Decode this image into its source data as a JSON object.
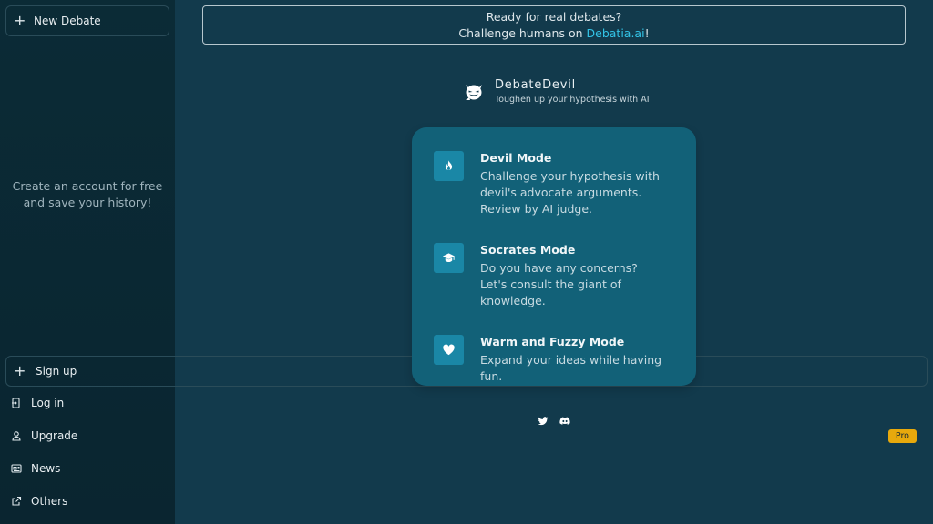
{
  "sidebar": {
    "new_debate_label": "New Debate",
    "promo_text_line1": "Create an account for free",
    "promo_text_line2": "and save your history!",
    "signup_label": "Sign up",
    "login_label": "Log in",
    "upgrade_label": "Upgrade",
    "upgrade_badge": "Pro",
    "news_label": "News",
    "others_label": "Others"
  },
  "banner": {
    "line1": "Ready for real debates?",
    "line2_prefix": "Challenge humans on ",
    "link_text": "Debatia.ai",
    "line2_suffix": "!"
  },
  "brand": {
    "name": "DebateDevil",
    "tagline": "Toughen up your hypothesis with AI"
  },
  "modes": [
    {
      "title": "Devil Mode",
      "icon": "flame-icon",
      "desc": "Challenge your hypothesis with devil's advocate arguments. Review by AI judge."
    },
    {
      "title": "Socrates Mode",
      "icon": "graduation-cap-icon",
      "desc": "Do you have any concerns? Let's consult the giant of knowledge."
    },
    {
      "title": "Warm and Fuzzy Mode",
      "icon": "heart-icon",
      "desc": "Expand your ideas while having fun."
    }
  ],
  "socials": [
    "twitter-icon",
    "discord-icon"
  ],
  "colors": {
    "background": "#123a4c",
    "sidebar": "#0b2b36",
    "card": "#126178",
    "icon_box": "#1a87a6",
    "link": "#33c3e6",
    "badge": "#e8a90c"
  }
}
